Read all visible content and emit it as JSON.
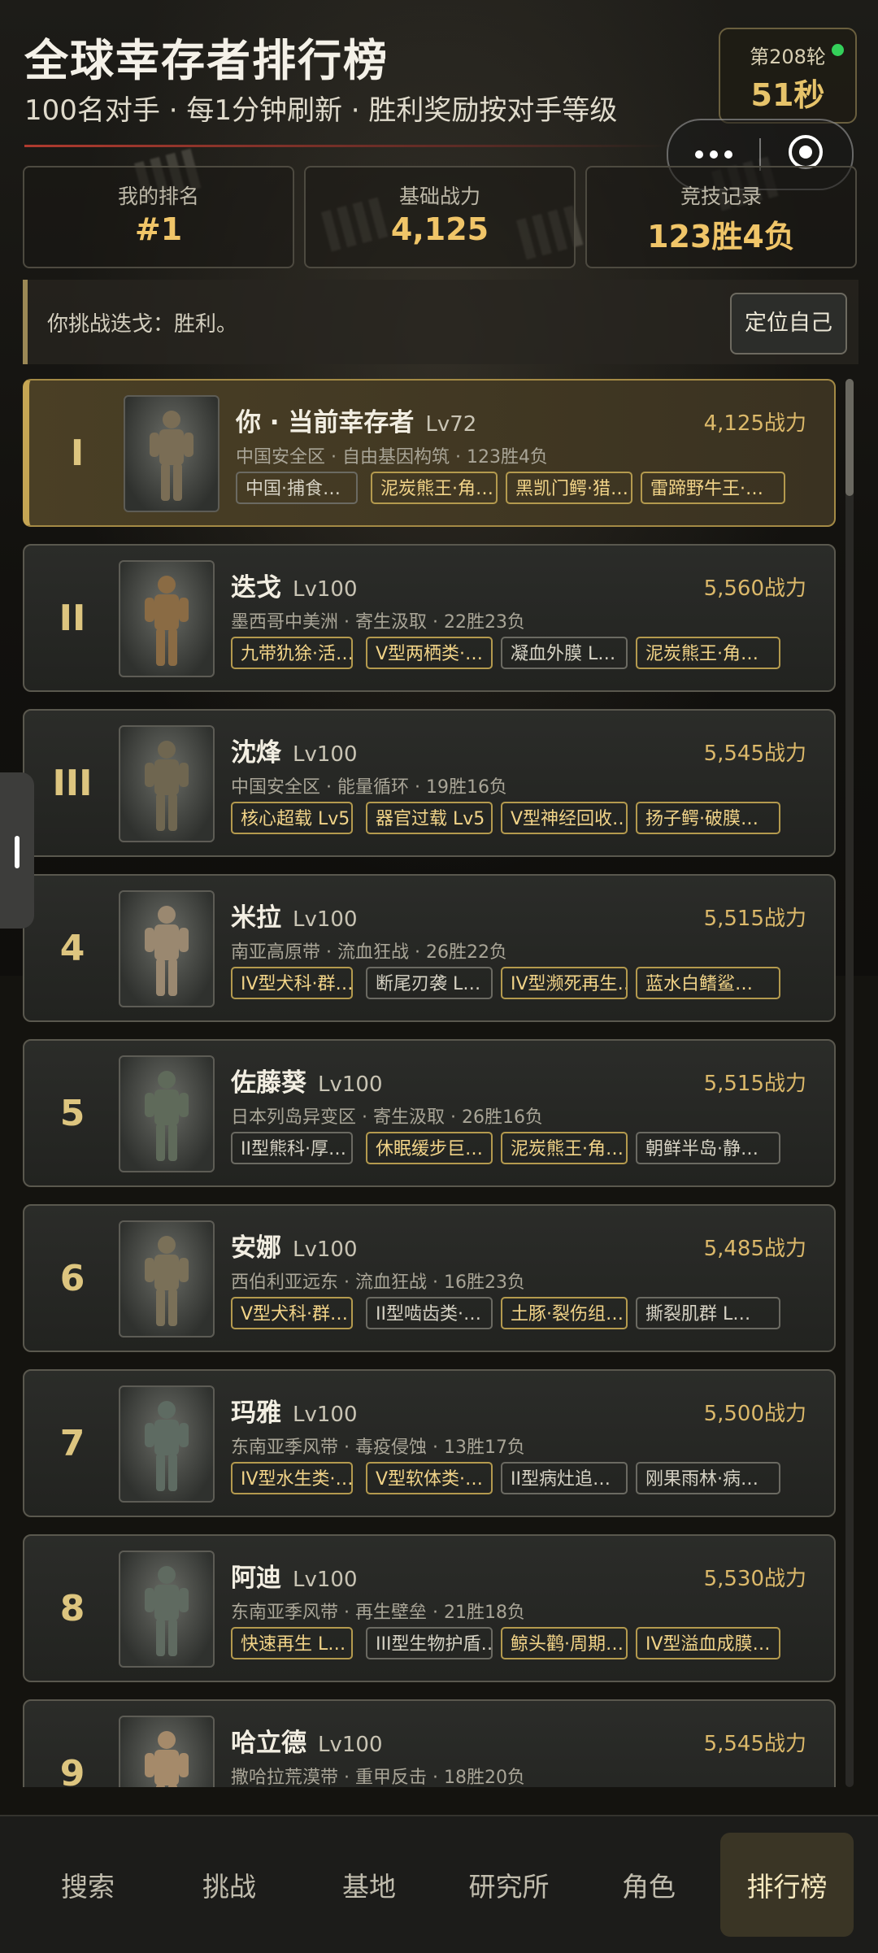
{
  "header": {
    "title": "全球幸存者排行榜",
    "subtitle": "100名对手 · 每1分钟刷新 · 胜利奖励按对手等级",
    "round_label": "第208轮",
    "round_timer": "51秒"
  },
  "stats": [
    {
      "label": "我的排名",
      "value": "#1"
    },
    {
      "label": "基础战力",
      "value": "4,125"
    },
    {
      "label": "竞技记录",
      "value": "123胜4负"
    }
  ],
  "notice": {
    "text": "你挑战迭戈：胜利。",
    "locate_button": "定位自己"
  },
  "rankings": [
    {
      "rank": "I",
      "name": "你 · 当前幸存者",
      "level": "Lv72",
      "power": "4,125战力",
      "sub": "中国安全区 · 自由基因构筑 · 123胜4负",
      "tags": [
        {
          "text": "中国·捕食…",
          "gold": false
        },
        {
          "text": "泥炭熊王·角…",
          "gold": true
        },
        {
          "text": "黑凯门鳄·猎…",
          "gold": true
        },
        {
          "text": "雷蹄野牛王·…",
          "gold": true
        }
      ]
    },
    {
      "rank": "II",
      "name": "迭戈",
      "level": "Lv100",
      "power": "5,560战力",
      "sub": "墨西哥中美洲 · 寄生汲取 · 22胜23负",
      "tags": [
        {
          "text": "九带犰狳·活…",
          "gold": true
        },
        {
          "text": "V型两栖类·…",
          "gold": true
        },
        {
          "text": "凝血外膜 L…",
          "gold": false
        },
        {
          "text": "泥炭熊王·角…",
          "gold": true
        }
      ]
    },
    {
      "rank": "III",
      "name": "沈烽",
      "level": "Lv100",
      "power": "5,545战力",
      "sub": "中国安全区 · 能量循环 · 19胜16负",
      "tags": [
        {
          "text": "核心超载 Lv5",
          "gold": true
        },
        {
          "text": "器官过载 Lv5",
          "gold": true
        },
        {
          "text": "V型神经回收…",
          "gold": true
        },
        {
          "text": "扬子鳄·破膜…",
          "gold": true
        }
      ]
    },
    {
      "rank": "4",
      "name": "米拉",
      "level": "Lv100",
      "power": "5,515战力",
      "sub": "南亚高原带 · 流血狂战 · 26胜22负",
      "tags": [
        {
          "text": "IV型犬科·群…",
          "gold": true
        },
        {
          "text": "断尾刃袭 L…",
          "gold": false
        },
        {
          "text": "IV型濒死再生…",
          "gold": true
        },
        {
          "text": "蓝水白鳍鲨…",
          "gold": true
        }
      ]
    },
    {
      "rank": "5",
      "name": "佐藤葵",
      "level": "Lv100",
      "power": "5,515战力",
      "sub": "日本列岛异变区 · 寄生汲取 · 26胜16负",
      "tags": [
        {
          "text": "II型熊科·厚…",
          "gold": false
        },
        {
          "text": "休眠缓步巨…",
          "gold": true
        },
        {
          "text": "泥炭熊王·角…",
          "gold": true
        },
        {
          "text": "朝鲜半岛·静…",
          "gold": false
        }
      ]
    },
    {
      "rank": "6",
      "name": "安娜",
      "level": "Lv100",
      "power": "5,485战力",
      "sub": "西伯利亚远东 · 流血狂战 · 16胜23负",
      "tags": [
        {
          "text": "V型犬科·群…",
          "gold": true
        },
        {
          "text": "II型啮齿类·…",
          "gold": false
        },
        {
          "text": "土豚·裂伤组…",
          "gold": true
        },
        {
          "text": "撕裂肌群 L…",
          "gold": false
        }
      ]
    },
    {
      "rank": "7",
      "name": "玛雅",
      "level": "Lv100",
      "power": "5,500战力",
      "sub": "东南亚季风带 · 毒疫侵蚀 · 13胜17负",
      "tags": [
        {
          "text": "IV型水生类·…",
          "gold": true
        },
        {
          "text": "V型软体类·…",
          "gold": true
        },
        {
          "text": "II型病灶追…",
          "gold": false
        },
        {
          "text": "刚果雨林·病…",
          "gold": false
        }
      ]
    },
    {
      "rank": "8",
      "name": "阿迪",
      "level": "Lv100",
      "power": "5,530战力",
      "sub": "东南亚季风带 · 再生壁垒 · 21胜18负",
      "tags": [
        {
          "text": "快速再生 L…",
          "gold": true
        },
        {
          "text": "III型生物护盾…",
          "gold": false
        },
        {
          "text": "鲸头鹳·周期…",
          "gold": true
        },
        {
          "text": "IV型溢血成膜…",
          "gold": true
        }
      ]
    },
    {
      "rank": "9",
      "name": "哈立德",
      "level": "Lv100",
      "power": "5,545战力",
      "sub": "撒哈拉荒漠带 · 重甲反击 · 18胜20负",
      "tags": []
    }
  ],
  "nav": [
    "搜索",
    "挑战",
    "基地",
    "研究所",
    "角色",
    "排行榜"
  ],
  "icons": {
    "more": "more-dots-icon",
    "close": "mini-program-close-icon"
  },
  "colors": {
    "accent_gold": "#f0c568",
    "online_dot": "#34d05a",
    "title_rule": "#b03a2e"
  }
}
